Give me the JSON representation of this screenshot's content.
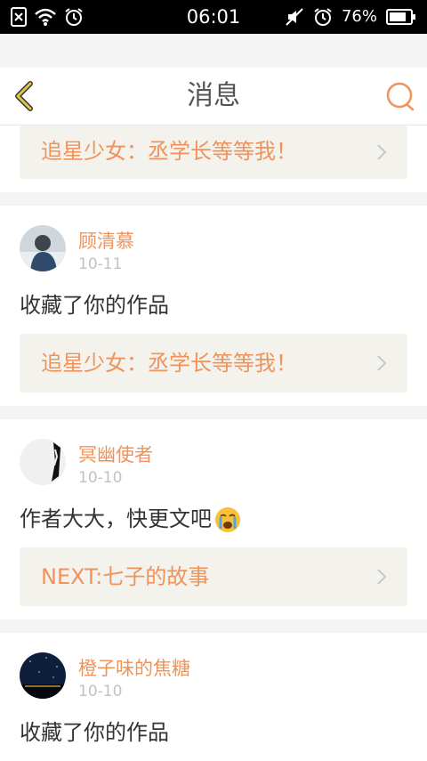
{
  "status_bar": {
    "time": "06:01",
    "battery": "76%"
  },
  "header": {
    "title": "消息"
  },
  "colors": {
    "accent": "#f0935a",
    "back_icon": "#e2c24b"
  },
  "notifications": [
    {
      "link_text": "追星少女：丞学长等等我！"
    },
    {
      "user": "顾清慕",
      "date": "10-11",
      "message": "收藏了你的作品",
      "link_text": "追星少女：丞学长等等我！"
    },
    {
      "user": "冥幽使者",
      "date": "10-10",
      "message": "作者大大，快更文吧",
      "link_text": "NEXT:七子的故事"
    },
    {
      "user": "橙子味的焦糖",
      "date": "10-10",
      "message": "收藏了你的作品"
    }
  ]
}
